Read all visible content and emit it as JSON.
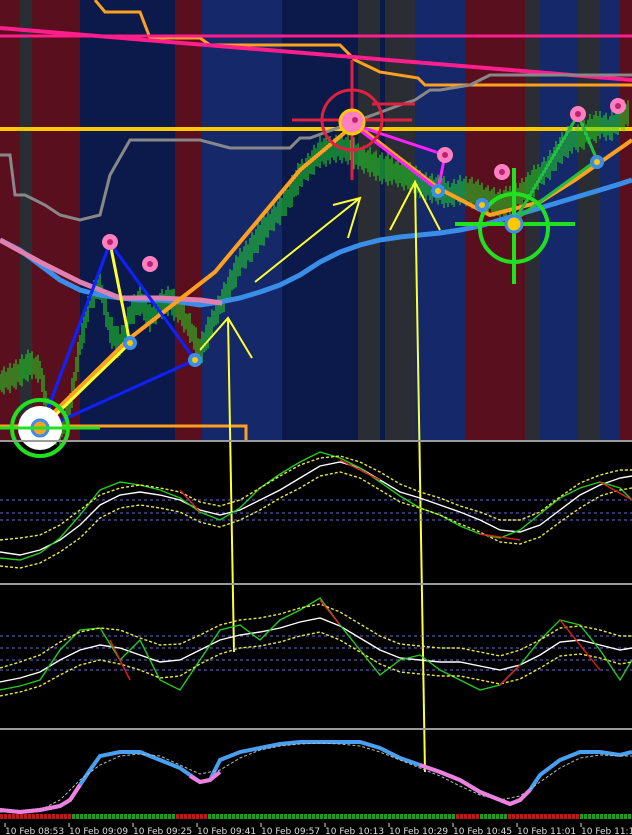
{
  "chart_data": [
    {
      "type": "line",
      "panel": "price",
      "background_colors": {
        "base": "#0b1a4a",
        "bull_zone": "#14286a",
        "bear_zone": "#5a0f1f",
        "neutral_zone": "#2a2d33"
      },
      "series": [
        {
          "key": "price",
          "color": "#22e022",
          "x": [
            0,
            10,
            20,
            30,
            40,
            50,
            60,
            70,
            80,
            90,
            100,
            110,
            120,
            130,
            140,
            150,
            160,
            170,
            180,
            190,
            200,
            210,
            220,
            230,
            240,
            250,
            260,
            270,
            280,
            290,
            300,
            310,
            320,
            330,
            340,
            350,
            360,
            370,
            380,
            390,
            400,
            410,
            420,
            430,
            440,
            450,
            460,
            470,
            480,
            490,
            500,
            510,
            520,
            530,
            540,
            550,
            560,
            570,
            580,
            590,
            600,
            610,
            620,
            630
          ],
          "values": [
            382,
            378,
            372,
            364,
            370,
            420,
            435,
            405,
            345,
            300,
            285,
            330,
            345,
            315,
            300,
            318,
            305,
            300,
            312,
            328,
            352,
            328,
            305,
            285,
            262,
            250,
            235,
            222,
            210,
            195,
            175,
            165,
            152,
            150,
            148,
            150,
            158,
            162,
            168,
            170,
            174,
            178,
            184,
            188,
            190,
            195,
            190,
            192,
            196,
            200,
            205,
            200,
            195,
            185,
            175,
            165,
            150,
            140,
            138,
            130,
            125,
            128,
            118,
            112
          ]
        },
        {
          "key": "ma_blue",
          "color": "#3a8ee8",
          "x": [
            0,
            20,
            40,
            60,
            80,
            100,
            120,
            140,
            160,
            180,
            200,
            220,
            240,
            260,
            280,
            300,
            320,
            340,
            360,
            380,
            400,
            420,
            440,
            460,
            480,
            500,
            520,
            540,
            560,
            580,
            600,
            620,
            632
          ],
          "values": [
            240,
            250,
            265,
            280,
            290,
            295,
            298,
            300,
            300,
            302,
            305,
            302,
            298,
            292,
            285,
            275,
            262,
            252,
            245,
            240,
            237,
            235,
            233,
            230,
            226,
            220,
            214,
            208,
            202,
            196,
            190,
            184,
            180
          ]
        },
        {
          "key": "ma_gray",
          "color": "#888888",
          "x": [
            0,
            10,
            15,
            25,
            45,
            60,
            80,
            100,
            110,
            130,
            160,
            200,
            230,
            250,
            270,
            290,
            300,
            310,
            400,
            415,
            430,
            440,
            470,
            490,
            600,
            632
          ],
          "values": [
            155,
            155,
            195,
            195,
            205,
            215,
            220,
            215,
            175,
            140,
            140,
            140,
            148,
            148,
            148,
            148,
            138,
            138,
            105,
            100,
            90,
            90,
            85,
            75,
            75,
            75
          ]
        }
      ]
    },
    {
      "type": "line",
      "panel": "oscillator_1",
      "reference_lines": [
        500,
        513,
        520
      ],
      "series": [
        {
          "key": "main",
          "color": "#ffffff",
          "x": [
            0,
            20,
            40,
            60,
            80,
            100,
            120,
            140,
            160,
            180,
            200,
            220,
            240,
            260,
            280,
            300,
            320,
            340,
            360,
            380,
            400,
            420,
            440,
            460,
            480,
            500,
            520,
            540,
            560,
            580,
            600,
            620,
            632
          ],
          "values": [
            552,
            555,
            550,
            540,
            525,
            505,
            495,
            492,
            495,
            500,
            510,
            515,
            510,
            500,
            490,
            478,
            466,
            462,
            468,
            480,
            492,
            498,
            505,
            512,
            520,
            530,
            532,
            525,
            510,
            495,
            485,
            478,
            476
          ]
        },
        {
          "key": "signal_up",
          "color": "#22cc22",
          "x": [
            0,
            20,
            40,
            60,
            80,
            100,
            120,
            140,
            160,
            180,
            200,
            220,
            240,
            260,
            280,
            300,
            320,
            340,
            360,
            380,
            400,
            420,
            440,
            460,
            480,
            500,
            520,
            540,
            560,
            580,
            600,
            620,
            632
          ],
          "values": [
            558,
            560,
            553,
            538,
            515,
            490,
            482,
            485,
            490,
            498,
            512,
            520,
            508,
            488,
            474,
            462,
            452,
            458,
            468,
            482,
            496,
            508,
            515,
            526,
            534,
            538,
            530,
            514,
            498,
            488,
            482,
            488,
            500
          ]
        },
        {
          "key": "env_upper",
          "color": "#e8e840",
          "x": [
            0,
            20,
            40,
            60,
            80,
            100,
            120,
            140,
            160,
            180,
            200,
            220,
            240,
            260,
            280,
            300,
            320,
            340,
            360,
            380,
            400,
            420,
            440,
            460,
            480,
            500,
            520,
            540,
            560,
            580,
            600,
            620,
            632
          ],
          "values": [
            540,
            538,
            535,
            525,
            510,
            495,
            488,
            485,
            488,
            492,
            502,
            506,
            500,
            488,
            476,
            465,
            458,
            456,
            462,
            472,
            484,
            492,
            498,
            506,
            512,
            520,
            520,
            512,
            497,
            483,
            475,
            470,
            470
          ]
        },
        {
          "key": "env_lower",
          "color": "#e8e840",
          "x": [
            0,
            20,
            40,
            60,
            80,
            100,
            120,
            140,
            160,
            180,
            200,
            220,
            240,
            260,
            280,
            300,
            320,
            340,
            360,
            380,
            400,
            420,
            440,
            460,
            480,
            500,
            520,
            540,
            560,
            580,
            600,
            620,
            632
          ],
          "values": [
            566,
            568,
            563,
            552,
            538,
            518,
            508,
            505,
            508,
            512,
            522,
            527,
            520,
            510,
            498,
            488,
            476,
            472,
            478,
            490,
            502,
            508,
            515,
            524,
            532,
            542,
            544,
            537,
            522,
            508,
            496,
            490,
            488
          ]
        }
      ]
    },
    {
      "type": "line",
      "panel": "oscillator_2",
      "reference_lines": [
        636,
        648,
        660,
        670
      ],
      "series": [
        {
          "key": "main",
          "color": "#ffffff",
          "x": [
            0,
            20,
            40,
            60,
            80,
            100,
            120,
            140,
            160,
            180,
            200,
            220,
            240,
            260,
            280,
            300,
            320,
            340,
            360,
            380,
            400,
            420,
            440,
            460,
            480,
            500,
            520,
            540,
            560,
            580,
            600,
            620,
            632
          ],
          "values": [
            682,
            678,
            672,
            660,
            650,
            645,
            648,
            655,
            662,
            660,
            650,
            640,
            635,
            632,
            628,
            622,
            618,
            626,
            638,
            650,
            658,
            660,
            662,
            662,
            666,
            670,
            665,
            655,
            642,
            640,
            645,
            650,
            648
          ]
        },
        {
          "key": "signal",
          "color": "#22cc22",
          "x": [
            0,
            20,
            40,
            60,
            80,
            100,
            120,
            140,
            160,
            180,
            200,
            220,
            240,
            260,
            280,
            300,
            320,
            340,
            360,
            380,
            400,
            420,
            440,
            460,
            480,
            500,
            520,
            540,
            560,
            580,
            600,
            620,
            632
          ],
          "values": [
            690,
            686,
            680,
            650,
            630,
            628,
            660,
            640,
            680,
            690,
            660,
            630,
            625,
            640,
            620,
            610,
            598,
            625,
            650,
            675,
            660,
            655,
            670,
            680,
            690,
            685,
            665,
            640,
            620,
            625,
            650,
            680,
            660
          ]
        },
        {
          "key": "env_upper",
          "color": "#e8e840",
          "x": [
            0,
            20,
            40,
            60,
            80,
            100,
            120,
            140,
            160,
            180,
            200,
            220,
            240,
            260,
            280,
            300,
            320,
            340,
            360,
            380,
            400,
            420,
            440,
            460,
            480,
            500,
            520,
            540,
            560,
            580,
            600,
            620,
            632
          ],
          "values": [
            668,
            662,
            655,
            642,
            632,
            628,
            630,
            638,
            645,
            644,
            635,
            625,
            620,
            618,
            614,
            608,
            604,
            612,
            624,
            636,
            644,
            646,
            648,
            648,
            652,
            656,
            650,
            640,
            628,
            626,
            630,
            636,
            636
          ]
        },
        {
          "key": "env_lower",
          "color": "#e8e840",
          "x": [
            0,
            20,
            40,
            60,
            80,
            100,
            120,
            140,
            160,
            180,
            200,
            220,
            240,
            260,
            280,
            300,
            320,
            340,
            360,
            380,
            400,
            420,
            440,
            460,
            480,
            500,
            520,
            540,
            560,
            580,
            600,
            620,
            632
          ],
          "values": [
            696,
            692,
            686,
            675,
            665,
            660,
            664,
            670,
            678,
            676,
            664,
            654,
            648,
            646,
            642,
            636,
            632,
            640,
            652,
            664,
            672,
            674,
            676,
            676,
            680,
            684,
            679,
            668,
            656,
            654,
            658,
            664,
            662
          ]
        }
      ]
    },
    {
      "type": "line",
      "panel": "oscillator_3",
      "series": [
        {
          "key": "main",
          "color": "#4aa0f0",
          "low_color": "#f080e0",
          "x": [
            0,
            20,
            40,
            60,
            70,
            80,
            90,
            100,
            120,
            140,
            160,
            180,
            200,
            210,
            220,
            240,
            260,
            280,
            300,
            320,
            340,
            360,
            380,
            400,
            420,
            440,
            460,
            480,
            500,
            510,
            520,
            530,
            540,
            560,
            580,
            600,
            620,
            632
          ],
          "values": [
            810,
            812,
            810,
            806,
            800,
            785,
            770,
            756,
            752,
            752,
            760,
            768,
            782,
            780,
            760,
            752,
            748,
            744,
            742,
            742,
            742,
            742,
            748,
            758,
            765,
            772,
            780,
            792,
            800,
            804,
            800,
            790,
            775,
            760,
            752,
            752,
            755,
            752
          ]
        },
        {
          "key": "signal",
          "color": "#bbbbbb",
          "x": [
            0,
            20,
            40,
            60,
            80,
            100,
            120,
            140,
            160,
            180,
            200,
            220,
            240,
            260,
            280,
            300,
            320,
            340,
            360,
            380,
            400,
            420,
            440,
            460,
            480,
            500,
            520,
            540,
            560,
            580,
            600,
            620,
            632
          ],
          "values": [
            812,
            812,
            810,
            800,
            780,
            765,
            756,
            754,
            756,
            765,
            774,
            770,
            758,
            750,
            746,
            744,
            743,
            744,
            746,
            752,
            760,
            768,
            776,
            786,
            795,
            800,
            796,
            782,
            768,
            758,
            755,
            756,
            756
          ]
        }
      ]
    },
    {
      "type": "bar",
      "panel": "histogram_strip",
      "categories": [
        "green",
        "red"
      ],
      "values": [
        1,
        1
      ]
    }
  ],
  "x_axis": {
    "ticks": [
      "10 Feb 08:53",
      "10 Feb 09:09",
      "10 Feb 09:25",
      "10 Feb 09:41",
      "10 Feb 09:57",
      "10 Feb 10:13",
      "10 Feb 10:29",
      "10 Feb 10:45",
      "10 Feb 11:01",
      "10 Feb 11:1"
    ]
  },
  "colors": {
    "pink_line": "#ff1e8c",
    "orange_line": "#ffa020",
    "gold_line": "#ffc800",
    "annotation_yellow": "#ffff30",
    "triangle_blue": "#1020ff",
    "triangle_magenta": "#ff20ff",
    "triangle_green": "#22c040",
    "target_red": "#e02040",
    "target_green": "#20e020",
    "dot_blue": "#3a8ee8",
    "dot_pink": "#ff80c0"
  }
}
